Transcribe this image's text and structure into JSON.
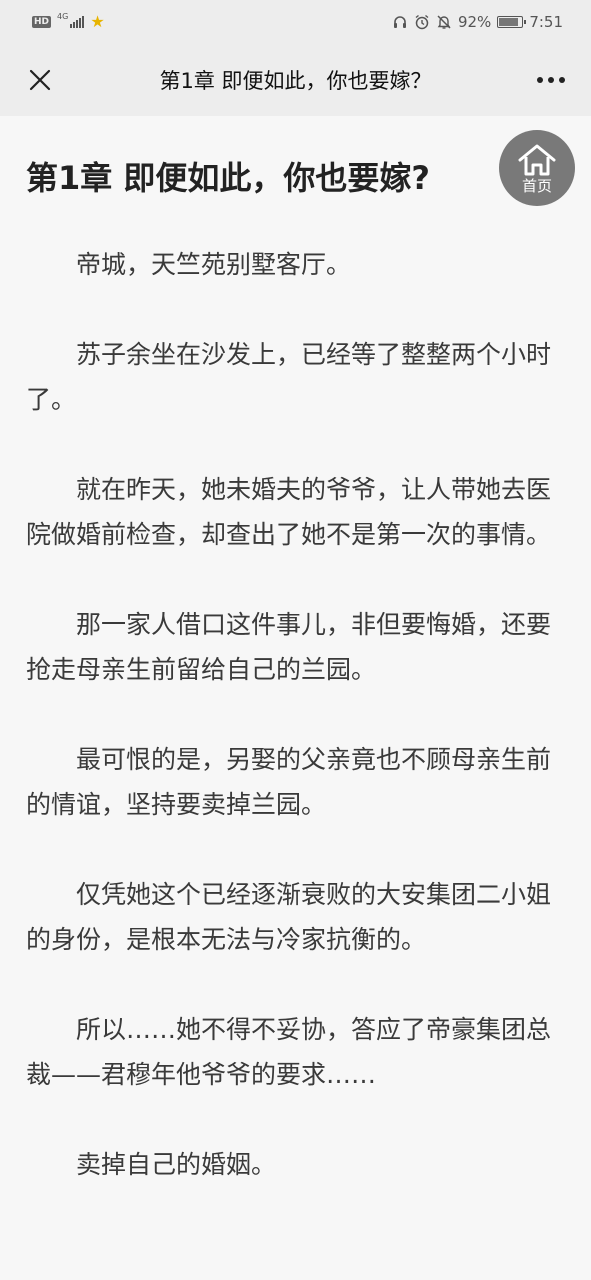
{
  "status_bar": {
    "hd_badge": "HD",
    "network": "4G",
    "battery_percent": "92%",
    "battery_level": 0.92,
    "time": "7:51",
    "icons": [
      "headphone-icon",
      "alarm-icon",
      "mute-icon",
      "star-icon"
    ]
  },
  "nav": {
    "title": "第1章 即便如此，你也要嫁？",
    "close_icon": "close-icon",
    "more_icon": "more-icon"
  },
  "article": {
    "chapter_title": "第1章 即便如此，你也要嫁?",
    "paragraphs": [
      "帝城，天竺苑别墅客厅。",
      "苏子余坐在沙发上，已经等了整整两个小时了。",
      "就在昨天，她未婚夫的爷爷，让人带她去医院做婚前检查，却查出了她不是第一次的事情。",
      "那一家人借口这件事儿，非但要悔婚，还要抢走母亲生前留给自己的兰园。",
      "最可恨的是，另娶的父亲竟也不顾母亲生前的情谊，坚持要卖掉兰园。",
      "仅凭她这个已经逐渐衰败的大安集团二小姐的身份，是根本无法与冷家抗衡的。",
      "所以……她不得不妥协，答应了帝豪集团总裁——君穆年他爷爷的要求……",
      "卖掉自己的婚姻。"
    ]
  },
  "home_button": {
    "label": "首页",
    "icon": "home-icon"
  },
  "colors": {
    "bar_bg": "#ededed",
    "page_bg": "#f7f7f7",
    "fab_bg": "#6e6e6e",
    "star": "#e7b400"
  }
}
